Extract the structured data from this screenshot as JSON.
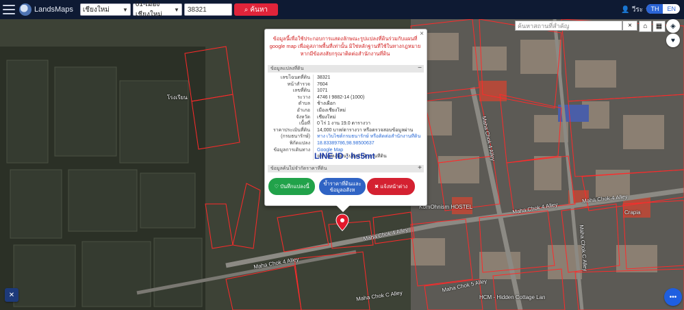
{
  "header": {
    "brand": "LandsMaps",
    "province_select": "เชียงใหม่",
    "district_select": "01-เมืองเชียงใหม่",
    "parcel_input": "38321",
    "search_label": "ค้นหา",
    "user_label": "วีระ",
    "lang_th": "TH",
    "lang_en": "EN"
  },
  "map": {
    "search_placeholder": "ค้นหาสถานที่สำคัญ",
    "close_symbol": "×",
    "street_labels": [
      "Maha Chok 4 Alley",
      "Maha Chok 4 Alley",
      "Maha Chok 4 Alley",
      "Maha Chok 4 Alley",
      "Maha Chok 5 Alley",
      "Maha Chok 4 Alley",
      "Maha Chok C Alley",
      "Maha Chok C Alley"
    ],
    "poi_labels": [
      "โรงเรียน",
      "Crapia",
      "HCM - Hidden Cottage Lan",
      "KomOhnism HOSTEL"
    ]
  },
  "popup": {
    "notice": "ข้อมูลนี้เพื่อใช้ประกอบการแสดงลักษณะรูปแปลงที่ดินร่วมกับแผนที่ google map เพื่อดูสภาพพื้นที่เท่านั้น มิใช่หลักฐานที่ใช้ในทางกฎหมาย หากมีข้อสงสัยกรุณาติดต่อสำนักงานที่ดิน",
    "section_land": "ข้อมูลแปลงที่ดิน",
    "section_land_toggle": "−",
    "section_price": "ข้อมูลค้นไม่จำกัดราคาที่ดิน",
    "section_price_toggle": "+",
    "close_symbol": "×",
    "rows": [
      {
        "k": "เลขโฉนดที่ดิน",
        "v": "38321"
      },
      {
        "k": "หน้าสำรวจ",
        "v": "7604"
      },
      {
        "k": "เลขที่ดิน",
        "v": "1071"
      },
      {
        "k": "ระวาง",
        "v": "4746 I 9882-14 (1000)"
      },
      {
        "k": "ตำบล",
        "v": "ช้างเผือก"
      },
      {
        "k": "อำเภอ",
        "v": "เมืองเชียงใหม่"
      },
      {
        "k": "จังหวัด",
        "v": "เชียงใหม่"
      },
      {
        "k": "เนื้อที่",
        "v": "0 ไร่ 1 งาน 19.0 ตารางวา"
      },
      {
        "k": "ราคาประเมินที่ดิน",
        "v": "14,000 บาท/ตารางวา หรือตรวจสอบข้อมูลผ่าน"
      },
      {
        "k": "(กรมธนารักษ์)",
        "v": "ทาง เว็บไซต์กรมธนารักษ์ หรือติดต่อสำนักงานที่ดิน"
      },
      {
        "k": "พิกัดแปลง",
        "v": "18.83389786,98.98500637"
      },
      {
        "k": "ข้อมูลการเดินทาง",
        "v": "Google Map"
      },
      {
        "k": "",
        "v": "จากแปลงที่ดินไปยังสำนักงานที่ดิน"
      }
    ],
    "watermark": "LINE ID : hs5mt",
    "btn_save": "♡ บันทึกแปลงนี้",
    "btn_price": "ข้ำราคาที่ดินและข้อมูลอสังห",
    "btn_report": "✖ แจ้งหน้าต่าง"
  },
  "colors": {
    "header_bg": "#0e1a33",
    "search_red": "#e0243a",
    "parcel_line": "#ff2a2a",
    "save_green": "#21a24a",
    "price_blue": "#2f63c4",
    "report_red": "#d42131"
  }
}
